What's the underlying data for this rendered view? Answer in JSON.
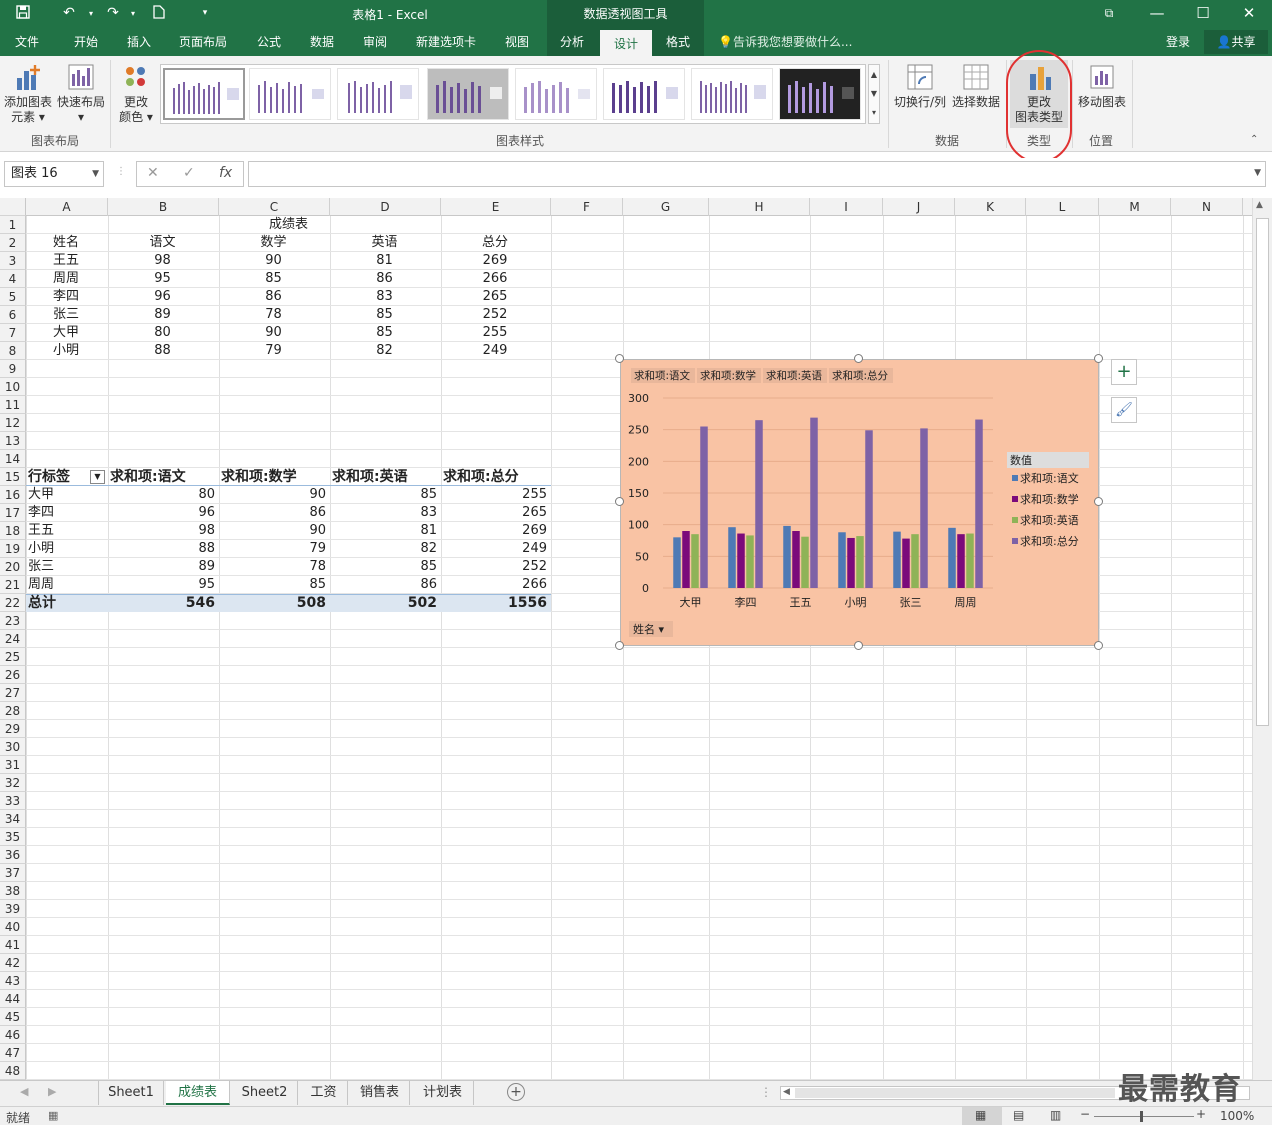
{
  "titlebar": {
    "title": "表格1 - Excel",
    "context_tools": "数据透视图工具",
    "restore_icon": "⧉",
    "min_icon": "—",
    "max_icon": "☐",
    "close_icon": "✕"
  },
  "tabs": [
    "文件",
    "开始",
    "插入",
    "页面布局",
    "公式",
    "数据",
    "审阅",
    "新建选项卡",
    "视图",
    "分析",
    "设计",
    "格式"
  ],
  "active_tab": "设计",
  "tell_me": "告诉我您想要做什么...",
  "login": "登录",
  "share": "共享",
  "ribbon": {
    "add_element": "添加图表\n元素 ▾",
    "add_element_l1": "添加图表",
    "add_element_l2": "元素 ▾",
    "quick_layout_l1": "快速布局",
    "quick_layout_l2": "▾",
    "change_color_l1": "更改",
    "change_color_l2": "颜色 ▾",
    "group_layout": "图表布局",
    "group_styles": "图表样式",
    "switch_rowcol": "切换行/列",
    "select_data": "选择数据",
    "group_data": "数据",
    "change_type_l1": "更改",
    "change_type_l2": "图表类型",
    "group_type": "类型",
    "move_chart": "移动图表",
    "group_location": "位置"
  },
  "formula_bar": {
    "name_box": "图表 16",
    "fx": "fx",
    "cancel": "✕",
    "enter": "✓"
  },
  "columns": [
    "A",
    "B",
    "C",
    "D",
    "E",
    "F",
    "G",
    "H",
    "I",
    "J",
    "K",
    "L",
    "M",
    "N"
  ],
  "rows": [
    "1",
    "2",
    "3",
    "4",
    "5",
    "6",
    "7",
    "8",
    "9",
    "10",
    "11",
    "12",
    "13",
    "14",
    "15",
    "16",
    "17",
    "18",
    "19",
    "20",
    "21",
    "22",
    "23",
    "24",
    "25",
    "26",
    "27",
    "28",
    "29",
    "30",
    "31",
    "32",
    "33",
    "34",
    "35",
    "36",
    "37",
    "38",
    "39",
    "40",
    "41",
    "42",
    "43",
    "44",
    "45",
    "46",
    "47",
    "48"
  ],
  "table": {
    "title": "成绩表",
    "headers": [
      "姓名",
      "语文",
      "数学",
      "英语",
      "总分"
    ],
    "data": [
      [
        "王五",
        "98",
        "90",
        "81",
        "269"
      ],
      [
        "周周",
        "95",
        "85",
        "86",
        "266"
      ],
      [
        "李四",
        "96",
        "86",
        "83",
        "265"
      ],
      [
        "张三",
        "89",
        "78",
        "85",
        "252"
      ],
      [
        "大甲",
        "80",
        "90",
        "85",
        "255"
      ],
      [
        "小明",
        "88",
        "79",
        "82",
        "249"
      ]
    ]
  },
  "pivot": {
    "headers": [
      "行标签",
      "求和项:语文",
      "求和项:数学",
      "求和项:英语",
      "求和项:总分"
    ],
    "rows": [
      [
        "大甲",
        "80",
        "90",
        "85",
        "255"
      ],
      [
        "李四",
        "96",
        "86",
        "83",
        "265"
      ],
      [
        "王五",
        "98",
        "90",
        "81",
        "269"
      ],
      [
        "小明",
        "88",
        "79",
        "82",
        "249"
      ],
      [
        "张三",
        "89",
        "78",
        "85",
        "252"
      ],
      [
        "周周",
        "95",
        "85",
        "86",
        "266"
      ]
    ],
    "total": [
      "总计",
      "546",
      "508",
      "502",
      "1556"
    ]
  },
  "chart_data": {
    "type": "bar",
    "field_buttons": [
      "求和项:语文",
      "求和项:数学",
      "求和项:英语",
      "求和项:总分"
    ],
    "categories": [
      "大甲",
      "李四",
      "王五",
      "小明",
      "张三",
      "周周"
    ],
    "series": [
      {
        "name": "求和项:语文",
        "values": [
          80,
          96,
          98,
          88,
          89,
          95
        ],
        "color": "#4e7ab5"
      },
      {
        "name": "求和项:数学",
        "values": [
          90,
          86,
          90,
          79,
          78,
          85
        ],
        "color": "#7b0a7b"
      },
      {
        "name": "求和项:英语",
        "values": [
          85,
          83,
          81,
          82,
          85,
          86
        ],
        "color": "#8fb357"
      },
      {
        "name": "求和项:总分",
        "values": [
          255,
          265,
          269,
          249,
          252,
          266
        ],
        "color": "#7e62a6"
      }
    ],
    "ylim": [
      0,
      300
    ],
    "yticks": [
      0,
      50,
      100,
      150,
      200,
      250,
      300
    ],
    "legend_title": "数值",
    "legend_position": "right",
    "axis_field": "姓名",
    "background": "#f9c3a4"
  },
  "sheets": [
    "Sheet1",
    "成绩表",
    "Sheet2",
    "工资",
    "销售表",
    "计划表"
  ],
  "active_sheet": "成绩表",
  "status": {
    "ready": "就绪",
    "zoom": "100%"
  },
  "watermark": "最需教育"
}
